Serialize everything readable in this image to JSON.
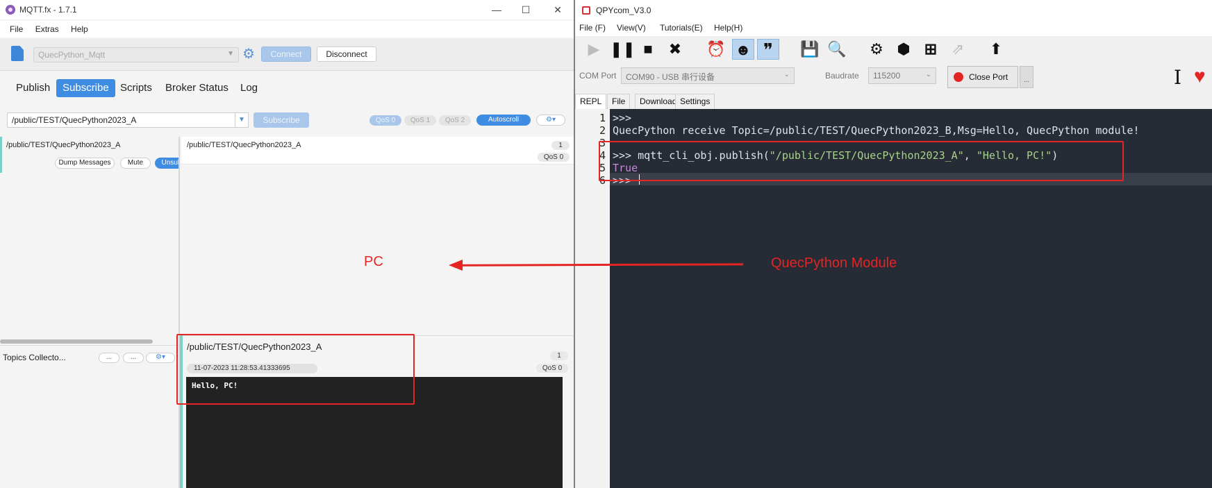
{
  "mqtt": {
    "title": "MQTT.fx - 1.7.1",
    "window_buttons": [
      "—",
      "☐",
      "✕"
    ],
    "menu": [
      "File",
      "Extras",
      "Help"
    ],
    "profile": "QuecPython_Mqtt",
    "connect_label": "Connect",
    "disconnect_label": "Disconnect",
    "tabs": [
      "Publish",
      "Subscribe",
      "Scripts",
      "Broker Status",
      "Log"
    ],
    "topic_input": "/public/TEST/QuecPython2023_A",
    "subscribe_label": "Subscribe",
    "qos": [
      "QoS 0",
      "QoS 1",
      "QoS 2"
    ],
    "autoscroll_label": "Autoscroll",
    "opts_label": "⚙▾",
    "subscribed_topic": "/public/TEST/QuecPython2023_A",
    "dump_label": "Dump Messages",
    "mute_label": "Mute",
    "unsub_label": "Unsub",
    "collector_label": "Topics Collecto...",
    "collector_btn": "...",
    "message_topic": "/public/TEST/QuecPython2023_A",
    "message_count": "1",
    "message_qos": "QoS 0",
    "detail_topic": "/public/TEST/QuecPython2023_A",
    "detail_count": "1",
    "detail_qos": "QoS 0",
    "timestamp": "11-07-2023  11:28:53.41333695",
    "payload": "Hello, PC!"
  },
  "qpy": {
    "title": "QPYcom_V3.0",
    "menu": [
      "File (F)",
      "View(V)",
      "Tutorials(E)",
      "Help(H)"
    ],
    "tools": [
      "play-icon",
      "pause-icon",
      "stop-icon",
      "close-icon",
      "alarm-icon",
      "robot-icon",
      "quote-icon",
      "save-icon",
      "search-icon",
      "settings-icon",
      "package-icon",
      "add-icon",
      "export-icon",
      "upload-icon"
    ],
    "com_port_label": "COM Port",
    "com_port_value": "COM90 - USB 串行设备",
    "baudrate_label": "Baudrate",
    "baudrate_value": "115200",
    "close_port_label": "Close Port",
    "more_label": "...",
    "tabs": [
      "REPL",
      "File",
      "Download",
      "Settings"
    ],
    "line_numbers": [
      "1",
      "2",
      "3",
      "4",
      "5",
      "6"
    ],
    "lines": {
      "l1": ">>>",
      "l2": "QuecPython receive Topic=/public/TEST/QuecPython2023_B,Msg=Hello, QuecPython module!",
      "l4_prefix": ">>> mqtt_cli_obj.publish(",
      "l4_arg1": "\"/public/TEST/QuecPython2023_A\"",
      "l4_sep": ", ",
      "l4_arg2": "\"Hello, PC!\"",
      "l4_suffix": ")",
      "l5": "True",
      "l6": ">>> "
    }
  },
  "annotations": {
    "pc_label": "PC",
    "module_label": "QuecPython Module",
    "color": "#e52424"
  }
}
